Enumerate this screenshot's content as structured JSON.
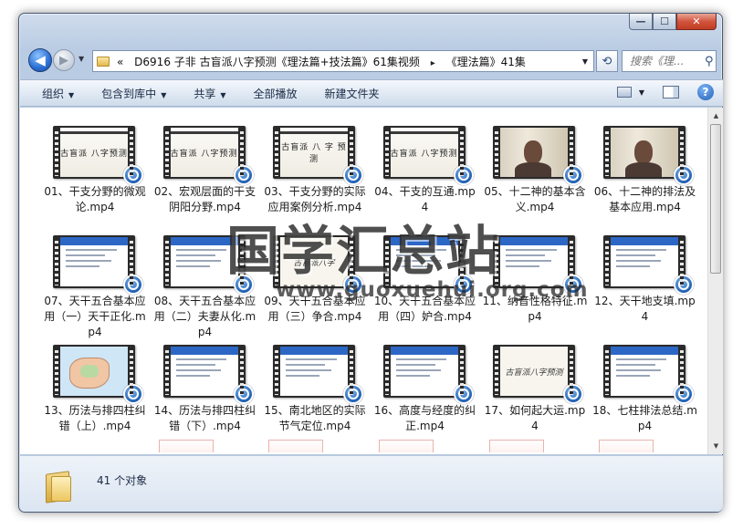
{
  "address": {
    "root_chevron": "«",
    "segments": [
      "D6916 子非 古盲派八字预测《理法篇+技法篇》61集视频",
      "《理法篇》41集"
    ],
    "separator": "▸"
  },
  "search": {
    "placeholder": "搜索《理..."
  },
  "toolbar": {
    "organize": "组织",
    "include_in_library": "包含到库中",
    "share": "共享",
    "play_all": "全部播放",
    "new_folder": "新建文件夹"
  },
  "files": [
    {
      "name": "01、干支分野的微观论.mp4",
      "thumb": "title",
      "caption": "古盲派 八字预测"
    },
    {
      "name": "02、宏观层面的干支阴阳分野.mp4",
      "thumb": "title",
      "caption": "古盲派 八字预测"
    },
    {
      "name": "03、干支分野的实际应用案例分析.mp4",
      "thumb": "title",
      "caption": "古盲派 八 字 预测"
    },
    {
      "name": "04、干支的互通.mp4",
      "thumb": "title",
      "caption": "古盲派 八字预测"
    },
    {
      "name": "05、十二神的基本含义.mp4",
      "thumb": "photo",
      "caption": ""
    },
    {
      "name": "06、十二神的排法及基本应用.mp4",
      "thumb": "photo",
      "caption": ""
    },
    {
      "name": "07、天干五合基本应用（一）天干正化.mp4",
      "thumb": "slide",
      "caption": ""
    },
    {
      "name": "08、天干五合基本应用（二）夫妻从化.mp4",
      "thumb": "slide",
      "caption": ""
    },
    {
      "name": "09、天干五合基本应用（三）争合.mp4",
      "thumb": "brush",
      "caption": "古盲派八字"
    },
    {
      "name": "10、天干五合基本应用（四）妒合.mp4",
      "thumb": "slide",
      "caption": ""
    },
    {
      "name": "11、纳音性格特征.mp4",
      "thumb": "slide",
      "caption": ""
    },
    {
      "name": "12、天干地支填.mp4",
      "thumb": "slide",
      "caption": ""
    },
    {
      "name": "13、历法与排四柱纠错（上）.mp4",
      "thumb": "map",
      "caption": ""
    },
    {
      "name": "14、历法与排四柱纠错（下）.mp4",
      "thumb": "slide",
      "caption": ""
    },
    {
      "name": "15、南北地区的实际节气定位.mp4",
      "thumb": "slide",
      "caption": ""
    },
    {
      "name": "16、高度与经度的纠正.mp4",
      "thumb": "slide",
      "caption": ""
    },
    {
      "name": "17、如何起大运.mp4",
      "thumb": "brush",
      "caption": "古盲派八字预测"
    },
    {
      "name": "18、七柱排法总结.mp4",
      "thumb": "slide",
      "caption": ""
    }
  ],
  "watermark": {
    "text": "国学汇总站",
    "url": "www.guoxuehui.org.com"
  },
  "status": {
    "count": "41 个对象"
  }
}
